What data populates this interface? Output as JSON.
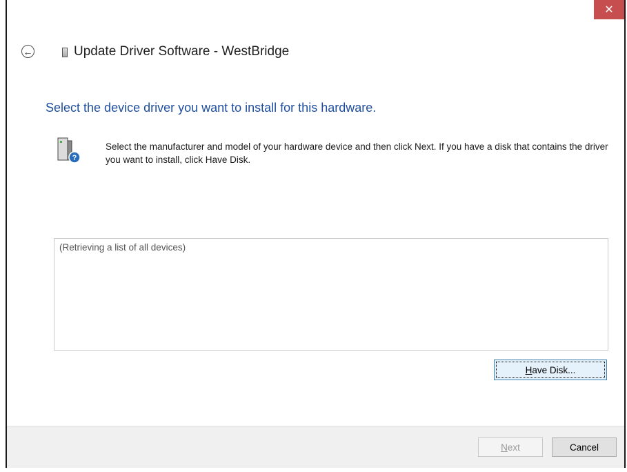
{
  "window": {
    "title": "Update Driver Software - WestBridge",
    "close_symbol": "✕"
  },
  "main": {
    "heading": "Select the device driver you want to install for this hardware.",
    "instruction": "Select the manufacturer and model of your hardware device and then click Next. If you have a disk that contains the driver you want to install, click Have Disk.",
    "device_list_status": "(Retrieving a list of all devices)",
    "have_disk_label_first": "H",
    "have_disk_label_rest": "ave Disk..."
  },
  "footer": {
    "next_label_first": "N",
    "next_label_rest": "ext",
    "cancel_label": "Cancel"
  },
  "icons": {
    "back": "back-arrow-icon",
    "device": "hardware-device-icon",
    "help": "question-icon"
  },
  "colors": {
    "heading": "#1f4e9e",
    "close": "#c74e4e",
    "accent_button": "#3c7fb1"
  }
}
